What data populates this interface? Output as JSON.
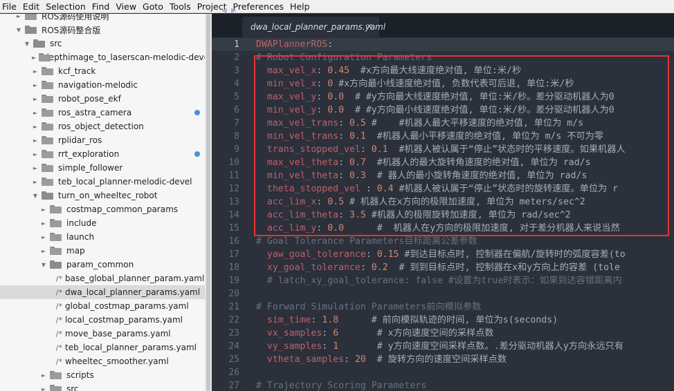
{
  "menu": [
    "File",
    "Edit",
    "Selection",
    "Find",
    "View",
    "Goto",
    "Tools",
    "Project",
    "Preferences",
    "Help"
  ],
  "sidebar": {
    "rows": [
      {
        "label": "ROS源码使用说明",
        "type": "folder",
        "open": false,
        "indent": 1,
        "arrow": "►"
      },
      {
        "label": "ROS源码整合版",
        "type": "folder",
        "open": true,
        "indent": 1,
        "arrow": "▼"
      },
      {
        "label": "src",
        "type": "folder",
        "open": true,
        "indent": 2,
        "arrow": "▼"
      },
      {
        "label": "depthimage_to_laserscan-melodic-devel",
        "type": "folder",
        "open": false,
        "indent": 3,
        "arrow": "►"
      },
      {
        "label": "kcf_track",
        "type": "folder",
        "open": false,
        "indent": 3,
        "arrow": "►"
      },
      {
        "label": "navigation-melodic",
        "type": "folder",
        "open": false,
        "indent": 3,
        "arrow": "►"
      },
      {
        "label": "robot_pose_ekf",
        "type": "folder",
        "open": false,
        "indent": 3,
        "arrow": "►"
      },
      {
        "label": "ros_astra_camera",
        "type": "folder",
        "open": false,
        "indent": 3,
        "arrow": "►",
        "dot": true
      },
      {
        "label": "ros_object_detection",
        "type": "folder",
        "open": false,
        "indent": 3,
        "arrow": "►"
      },
      {
        "label": "rplidar_ros",
        "type": "folder",
        "open": false,
        "indent": 3,
        "arrow": "►"
      },
      {
        "label": "rrt_exploration",
        "type": "folder",
        "open": false,
        "indent": 3,
        "arrow": "►",
        "dot": true
      },
      {
        "label": "simple_follower",
        "type": "folder",
        "open": false,
        "indent": 3,
        "arrow": "►"
      },
      {
        "label": "teb_local_planner-melodic-devel",
        "type": "folder",
        "open": false,
        "indent": 3,
        "arrow": "►"
      },
      {
        "label": "turn_on_wheeltec_robot",
        "type": "folder",
        "open": true,
        "indent": 3,
        "arrow": "▼"
      },
      {
        "label": "costmap_common_params",
        "type": "folder",
        "open": false,
        "indent": 4,
        "arrow": "►"
      },
      {
        "label": "include",
        "type": "folder",
        "open": false,
        "indent": 4,
        "arrow": "►"
      },
      {
        "label": "launch",
        "type": "folder",
        "open": false,
        "indent": 4,
        "arrow": "►"
      },
      {
        "label": "map",
        "type": "folder",
        "open": false,
        "indent": 4,
        "arrow": "►"
      },
      {
        "label": "param_common",
        "type": "folder",
        "open": true,
        "indent": 4,
        "arrow": "▼"
      },
      {
        "label": "base_global_planner_param.yaml",
        "type": "file",
        "indent": 5
      },
      {
        "label": "dwa_local_planner_params.yaml",
        "type": "file",
        "indent": 5,
        "selected": true
      },
      {
        "label": "global_costmap_params.yaml",
        "type": "file",
        "indent": 5
      },
      {
        "label": "local_costmap_params.yaml",
        "type": "file",
        "indent": 5
      },
      {
        "label": "move_base_params.yaml",
        "type": "file",
        "indent": 5
      },
      {
        "label": "teb_local_planner_params.yaml",
        "type": "file",
        "indent": 5
      },
      {
        "label": "wheeltec_smoother.yaml",
        "type": "file",
        "indent": 5
      },
      {
        "label": "scripts",
        "type": "folder",
        "open": false,
        "indent": 4,
        "arrow": "►"
      },
      {
        "label": "src",
        "type": "folder",
        "open": false,
        "indent": 4,
        "arrow": "►"
      }
    ],
    "file_icon": "/*"
  },
  "tabbar": {
    "nav_left": "◀",
    "nav_right": "▶",
    "tab_title": "dwa_local_planner_params.yaml",
    "tab_close": "×"
  },
  "editor": {
    "lines": [
      {
        "n": "1",
        "segs": [
          [
            "k",
            "DWAPlannerROS"
          ],
          [
            "c",
            ":"
          ]
        ]
      },
      {
        "n": "2",
        "segs": [
          [
            "cm",
            "# Robot Configuration Parameters"
          ]
        ]
      },
      {
        "n": "3",
        "segs": [
          [
            "c",
            "  "
          ],
          [
            "k",
            "max_vel_x"
          ],
          [
            "c",
            ": "
          ],
          [
            "v",
            "0.45"
          ],
          [
            "c",
            "  #x方向最大线速度绝对值, 单位:米/秒"
          ]
        ]
      },
      {
        "n": "4",
        "segs": [
          [
            "c",
            "  "
          ],
          [
            "k",
            "min_vel_x"
          ],
          [
            "c",
            ": "
          ],
          [
            "v",
            "0"
          ],
          [
            "c",
            " #x方向最小线速度绝对值, 负数代表可后退, 单位:米/秒"
          ]
        ]
      },
      {
        "n": "5",
        "segs": [
          [
            "c",
            "  "
          ],
          [
            "k",
            "max_vel_y"
          ],
          [
            "c",
            ": "
          ],
          [
            "v",
            "0.0"
          ],
          [
            "c",
            "  # #y方向最大线速度绝对值, 单位:米/秒。差分驱动机器人为0"
          ]
        ]
      },
      {
        "n": "6",
        "segs": [
          [
            "c",
            "  "
          ],
          [
            "k",
            "min_vel_y"
          ],
          [
            "c",
            ": "
          ],
          [
            "v",
            "0.0"
          ],
          [
            "c",
            "  # #y方向最小线速度绝对值, 单位:米/秒。差分驱动机器人为0"
          ]
        ]
      },
      {
        "n": "7",
        "segs": [
          [
            "c",
            "  "
          ],
          [
            "k",
            "max_vel_trans"
          ],
          [
            "c",
            ": "
          ],
          [
            "v",
            "0.5"
          ],
          [
            "c",
            " #    #机器人最大平移速度的绝对值, 单位为 m/s"
          ]
        ]
      },
      {
        "n": "8",
        "segs": [
          [
            "c",
            "  "
          ],
          [
            "k",
            "min_vel_trans"
          ],
          [
            "c",
            ": "
          ],
          [
            "v",
            "0.1"
          ],
          [
            "c",
            "  #机器人最小平移速度的绝对值, 单位为 m/s 不可为零"
          ]
        ]
      },
      {
        "n": "9",
        "segs": [
          [
            "c",
            "  "
          ],
          [
            "k",
            "trans_stopped_vel"
          ],
          [
            "c",
            ": "
          ],
          [
            "v",
            "0.1"
          ],
          [
            "c",
            "  #机器人被认属于“停止”状态时的平移速度。如果机器人"
          ]
        ]
      },
      {
        "n": "10",
        "segs": [
          [
            "c",
            "  "
          ],
          [
            "k",
            "max_vel_theta"
          ],
          [
            "c",
            ": "
          ],
          [
            "v",
            "0.7"
          ],
          [
            "c",
            "  #机器人的最大旋转角速度的绝对值, 单位为 rad/s"
          ]
        ]
      },
      {
        "n": "11",
        "segs": [
          [
            "c",
            "  "
          ],
          [
            "k",
            "min_vel_theta"
          ],
          [
            "c",
            ": "
          ],
          [
            "v",
            "0.3"
          ],
          [
            "c",
            "  # 器人的最小旋转角速度的绝对值, 单位为 rad/s"
          ]
        ]
      },
      {
        "n": "12",
        "segs": [
          [
            "c",
            "  "
          ],
          [
            "k",
            "theta_stopped_vel"
          ],
          [
            "c",
            " : "
          ],
          [
            "v",
            "0.4"
          ],
          [
            "c",
            " #机器人被认属于“停止”状态时的旋转速度。单位为 r"
          ]
        ]
      },
      {
        "n": "13",
        "segs": [
          [
            "c",
            "  "
          ],
          [
            "k",
            "acc_lim_x"
          ],
          [
            "c",
            ": "
          ],
          [
            "v",
            "0.5"
          ],
          [
            "c",
            " # 机器人在x方向的极限加速度, 单位为 meters/sec^2"
          ]
        ]
      },
      {
        "n": "14",
        "segs": [
          [
            "c",
            "  "
          ],
          [
            "k",
            "acc_lim_theta"
          ],
          [
            "c",
            ": "
          ],
          [
            "v",
            "3.5"
          ],
          [
            "c",
            " #机器人的极限旋转加速度, 单位为 rad/sec^2"
          ]
        ]
      },
      {
        "n": "15",
        "segs": [
          [
            "c",
            "  "
          ],
          [
            "k",
            "acc_lim_y"
          ],
          [
            "c",
            ": "
          ],
          [
            "v",
            "0.0"
          ],
          [
            "c",
            "      #  机器人在y方向的极限加速度, 对于差分机器人来说当然"
          ]
        ]
      },
      {
        "n": "16",
        "segs": [
          [
            "cm",
            "# Goal Tolerance Parameters目标距离公差参数"
          ]
        ]
      },
      {
        "n": "17",
        "segs": [
          [
            "c",
            "  "
          ],
          [
            "k",
            "yaw_goal_tolerance"
          ],
          [
            "c",
            ": "
          ],
          [
            "v",
            "0.15"
          ],
          [
            "c",
            " #到达目标点时, 控制器在偏航/旋转时的弧度容差(to"
          ]
        ]
      },
      {
        "n": "18",
        "segs": [
          [
            "c",
            "  "
          ],
          [
            "k",
            "xy_goal_tolerance"
          ],
          [
            "c",
            ": "
          ],
          [
            "v",
            "0.2"
          ],
          [
            "c",
            "  # 到到目标点时, 控制器在x和y方向上的容差 (tole"
          ]
        ]
      },
      {
        "n": "19",
        "segs": [
          [
            "cm",
            "  # latch_xy_goal_tolerance: false #设置为true时表示：如果到达容错距离内"
          ]
        ]
      },
      {
        "n": "20",
        "segs": [
          [
            "c",
            ""
          ]
        ]
      },
      {
        "n": "21",
        "segs": [
          [
            "cm",
            "# Forward Simulation Parameters前向模拟参数"
          ]
        ]
      },
      {
        "n": "22",
        "segs": [
          [
            "c",
            "  "
          ],
          [
            "k",
            "sim_time"
          ],
          [
            "c",
            ": "
          ],
          [
            "v",
            "1.8"
          ],
          [
            "c",
            "      # 前向模拟轨迹的时间, 单位为s(seconds)"
          ]
        ]
      },
      {
        "n": "23",
        "segs": [
          [
            "c",
            "  "
          ],
          [
            "k",
            "vx_samples"
          ],
          [
            "c",
            ": "
          ],
          [
            "v",
            "6"
          ],
          [
            "c",
            "       # x方向速度空间的采样点数"
          ]
        ]
      },
      {
        "n": "24",
        "segs": [
          [
            "c",
            "  "
          ],
          [
            "k",
            "vy_samples"
          ],
          [
            "c",
            ": "
          ],
          [
            "v",
            "1"
          ],
          [
            "c",
            "       # y方向速度空间采样点数。.差分驱动机器人y方向永远只有"
          ]
        ]
      },
      {
        "n": "25",
        "segs": [
          [
            "c",
            "  "
          ],
          [
            "k",
            "vtheta_samples"
          ],
          [
            "c",
            ": "
          ],
          [
            "v",
            "20"
          ],
          [
            "c",
            "  # 旋转方向的速度空间采样点数"
          ]
        ]
      },
      {
        "n": "26",
        "segs": [
          [
            "c",
            ""
          ]
        ]
      },
      {
        "n": "27",
        "segs": [
          [
            "cm",
            "# Trajectory Scoring Parameters"
          ]
        ]
      }
    ]
  }
}
